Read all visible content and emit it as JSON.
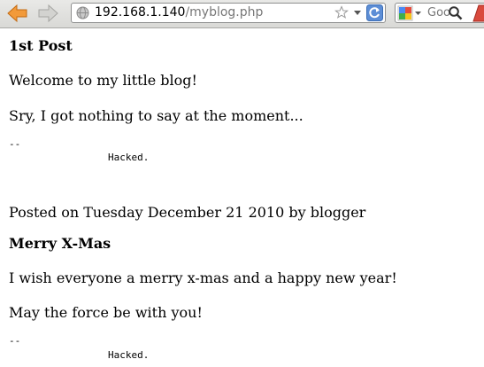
{
  "browser": {
    "url_host": "192.168.1.140",
    "url_path": "/myblog.php",
    "search_placeholder": "Goo"
  },
  "posts": [
    {
      "title": "1st Post",
      "paragraphs": [
        "Welcome to my little blog!",
        "Sry, I got nothing to say at the moment..."
      ],
      "sig_dash": "--",
      "signature": "Hacked."
    },
    {
      "meta": "Posted on Tuesday December 21 2010 by blogger",
      "title": "Merry X-Mas",
      "paragraphs": [
        "I wish everyone a merry x-mas and a happy new year!",
        "May the force be with you!"
      ],
      "sig_dash": "--",
      "signature": "Hacked."
    }
  ]
}
